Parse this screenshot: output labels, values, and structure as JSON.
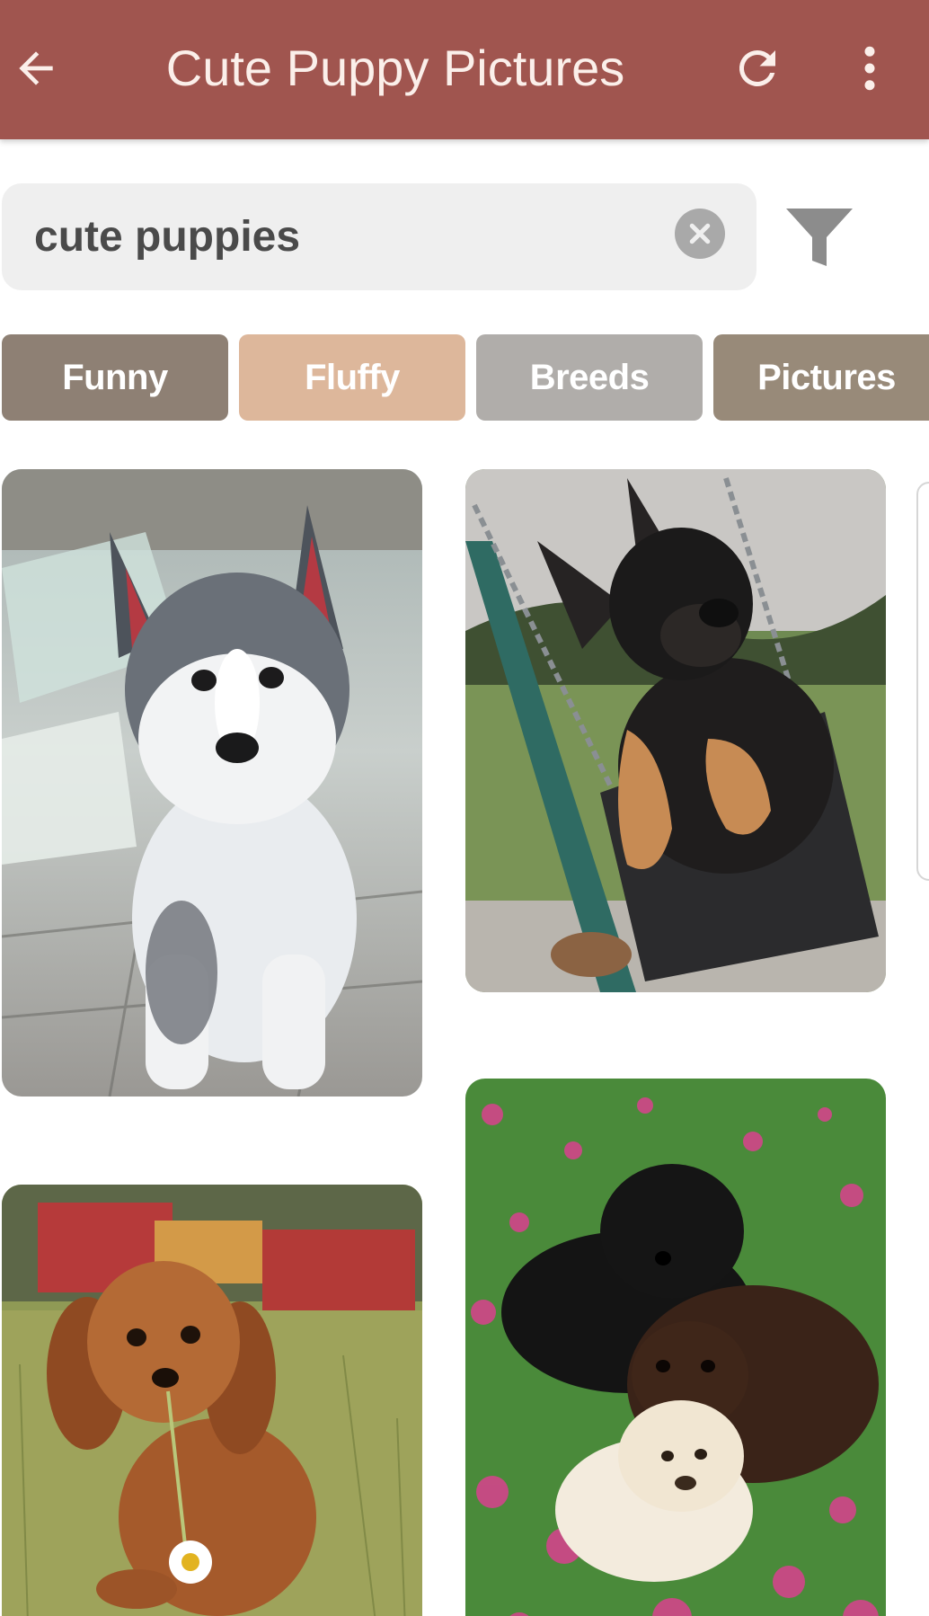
{
  "app_bar": {
    "title": "Cute Puppy Pictures",
    "background": "#a0554f",
    "icons": [
      "back-arrow-icon",
      "refresh-icon",
      "more-vert-icon"
    ]
  },
  "search": {
    "value": "cute puppies",
    "placeholder": "",
    "clear_icon": "clear-icon",
    "filter_icon": "filter-icon"
  },
  "chips": [
    {
      "label": "Funny",
      "color": "#8e8074"
    },
    {
      "label": "Fluffy",
      "color": "#ddb79b"
    },
    {
      "label": "Breeds",
      "color": "#b0adaa"
    },
    {
      "label": "Pictures",
      "color": "#988a79"
    }
  ],
  "photos": [
    {
      "subject": "husky puppy"
    },
    {
      "subject": "german shepherd puppy in swing"
    },
    {
      "subject": "cavalier puppy with daisy"
    },
    {
      "subject": "three puppies in flowers"
    }
  ]
}
